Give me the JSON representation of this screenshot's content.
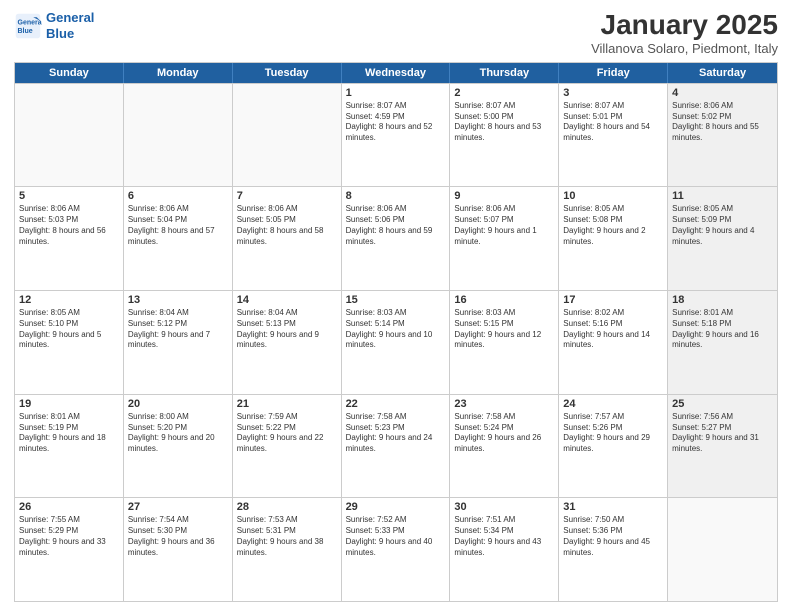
{
  "logo": {
    "line1": "General",
    "line2": "Blue"
  },
  "header": {
    "title": "January 2025",
    "subtitle": "Villanova Solaro, Piedmont, Italy"
  },
  "weekdays": [
    "Sunday",
    "Monday",
    "Tuesday",
    "Wednesday",
    "Thursday",
    "Friday",
    "Saturday"
  ],
  "rows": [
    [
      {
        "day": "",
        "text": "",
        "empty": true
      },
      {
        "day": "",
        "text": "",
        "empty": true
      },
      {
        "day": "",
        "text": "",
        "empty": true
      },
      {
        "day": "1",
        "text": "Sunrise: 8:07 AM\nSunset: 4:59 PM\nDaylight: 8 hours and 52 minutes."
      },
      {
        "day": "2",
        "text": "Sunrise: 8:07 AM\nSunset: 5:00 PM\nDaylight: 8 hours and 53 minutes."
      },
      {
        "day": "3",
        "text": "Sunrise: 8:07 AM\nSunset: 5:01 PM\nDaylight: 8 hours and 54 minutes."
      },
      {
        "day": "4",
        "text": "Sunrise: 8:06 AM\nSunset: 5:02 PM\nDaylight: 8 hours and 55 minutes.",
        "shaded": true
      }
    ],
    [
      {
        "day": "5",
        "text": "Sunrise: 8:06 AM\nSunset: 5:03 PM\nDaylight: 8 hours and 56 minutes."
      },
      {
        "day": "6",
        "text": "Sunrise: 8:06 AM\nSunset: 5:04 PM\nDaylight: 8 hours and 57 minutes."
      },
      {
        "day": "7",
        "text": "Sunrise: 8:06 AM\nSunset: 5:05 PM\nDaylight: 8 hours and 58 minutes."
      },
      {
        "day": "8",
        "text": "Sunrise: 8:06 AM\nSunset: 5:06 PM\nDaylight: 8 hours and 59 minutes."
      },
      {
        "day": "9",
        "text": "Sunrise: 8:06 AM\nSunset: 5:07 PM\nDaylight: 9 hours and 1 minute."
      },
      {
        "day": "10",
        "text": "Sunrise: 8:05 AM\nSunset: 5:08 PM\nDaylight: 9 hours and 2 minutes."
      },
      {
        "day": "11",
        "text": "Sunrise: 8:05 AM\nSunset: 5:09 PM\nDaylight: 9 hours and 4 minutes.",
        "shaded": true
      }
    ],
    [
      {
        "day": "12",
        "text": "Sunrise: 8:05 AM\nSunset: 5:10 PM\nDaylight: 9 hours and 5 minutes."
      },
      {
        "day": "13",
        "text": "Sunrise: 8:04 AM\nSunset: 5:12 PM\nDaylight: 9 hours and 7 minutes."
      },
      {
        "day": "14",
        "text": "Sunrise: 8:04 AM\nSunset: 5:13 PM\nDaylight: 9 hours and 9 minutes."
      },
      {
        "day": "15",
        "text": "Sunrise: 8:03 AM\nSunset: 5:14 PM\nDaylight: 9 hours and 10 minutes."
      },
      {
        "day": "16",
        "text": "Sunrise: 8:03 AM\nSunset: 5:15 PM\nDaylight: 9 hours and 12 minutes."
      },
      {
        "day": "17",
        "text": "Sunrise: 8:02 AM\nSunset: 5:16 PM\nDaylight: 9 hours and 14 minutes."
      },
      {
        "day": "18",
        "text": "Sunrise: 8:01 AM\nSunset: 5:18 PM\nDaylight: 9 hours and 16 minutes.",
        "shaded": true
      }
    ],
    [
      {
        "day": "19",
        "text": "Sunrise: 8:01 AM\nSunset: 5:19 PM\nDaylight: 9 hours and 18 minutes."
      },
      {
        "day": "20",
        "text": "Sunrise: 8:00 AM\nSunset: 5:20 PM\nDaylight: 9 hours and 20 minutes."
      },
      {
        "day": "21",
        "text": "Sunrise: 7:59 AM\nSunset: 5:22 PM\nDaylight: 9 hours and 22 minutes."
      },
      {
        "day": "22",
        "text": "Sunrise: 7:58 AM\nSunset: 5:23 PM\nDaylight: 9 hours and 24 minutes."
      },
      {
        "day": "23",
        "text": "Sunrise: 7:58 AM\nSunset: 5:24 PM\nDaylight: 9 hours and 26 minutes."
      },
      {
        "day": "24",
        "text": "Sunrise: 7:57 AM\nSunset: 5:26 PM\nDaylight: 9 hours and 29 minutes."
      },
      {
        "day": "25",
        "text": "Sunrise: 7:56 AM\nSunset: 5:27 PM\nDaylight: 9 hours and 31 minutes.",
        "shaded": true
      }
    ],
    [
      {
        "day": "26",
        "text": "Sunrise: 7:55 AM\nSunset: 5:29 PM\nDaylight: 9 hours and 33 minutes."
      },
      {
        "day": "27",
        "text": "Sunrise: 7:54 AM\nSunset: 5:30 PM\nDaylight: 9 hours and 36 minutes."
      },
      {
        "day": "28",
        "text": "Sunrise: 7:53 AM\nSunset: 5:31 PM\nDaylight: 9 hours and 38 minutes."
      },
      {
        "day": "29",
        "text": "Sunrise: 7:52 AM\nSunset: 5:33 PM\nDaylight: 9 hours and 40 minutes."
      },
      {
        "day": "30",
        "text": "Sunrise: 7:51 AM\nSunset: 5:34 PM\nDaylight: 9 hours and 43 minutes."
      },
      {
        "day": "31",
        "text": "Sunrise: 7:50 AM\nSunset: 5:36 PM\nDaylight: 9 hours and 45 minutes."
      },
      {
        "day": "",
        "text": "",
        "empty": true,
        "shaded": true
      }
    ]
  ]
}
